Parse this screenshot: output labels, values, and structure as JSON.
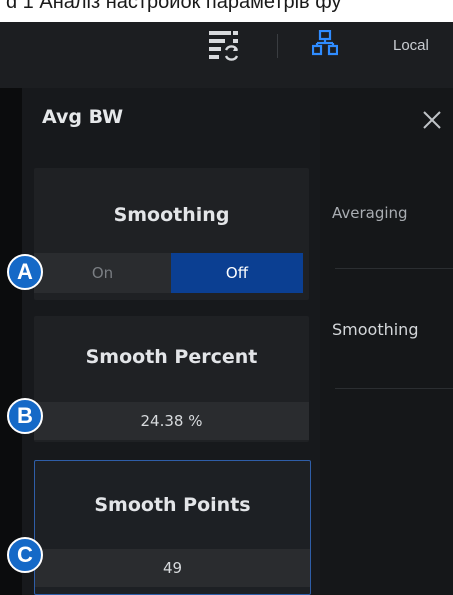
{
  "caption": "d 1 Аналіз настройок параметрів фу",
  "topbar": {
    "menu_icon": "menu-sync-icon",
    "network_icon": "network-icon",
    "local_label": "Local"
  },
  "panel": {
    "title": "Avg BW",
    "close_icon": "close-icon"
  },
  "right_list": {
    "items": [
      "Averaging",
      "Smoothing"
    ]
  },
  "cards": {
    "smoothing": {
      "title": "Smoothing",
      "on_label": "On",
      "off_label": "Off",
      "selected": "Off"
    },
    "smooth_percent": {
      "title": "Smooth Percent",
      "value": "24.38 %"
    },
    "smooth_points": {
      "title": "Smooth Points",
      "value": "49"
    }
  },
  "markers": [
    "A",
    "B",
    "C"
  ],
  "colors": {
    "accent": "#0b3f92",
    "marker": "#1569c7",
    "selected_border": "#2f5ea8",
    "background": "#151719"
  }
}
